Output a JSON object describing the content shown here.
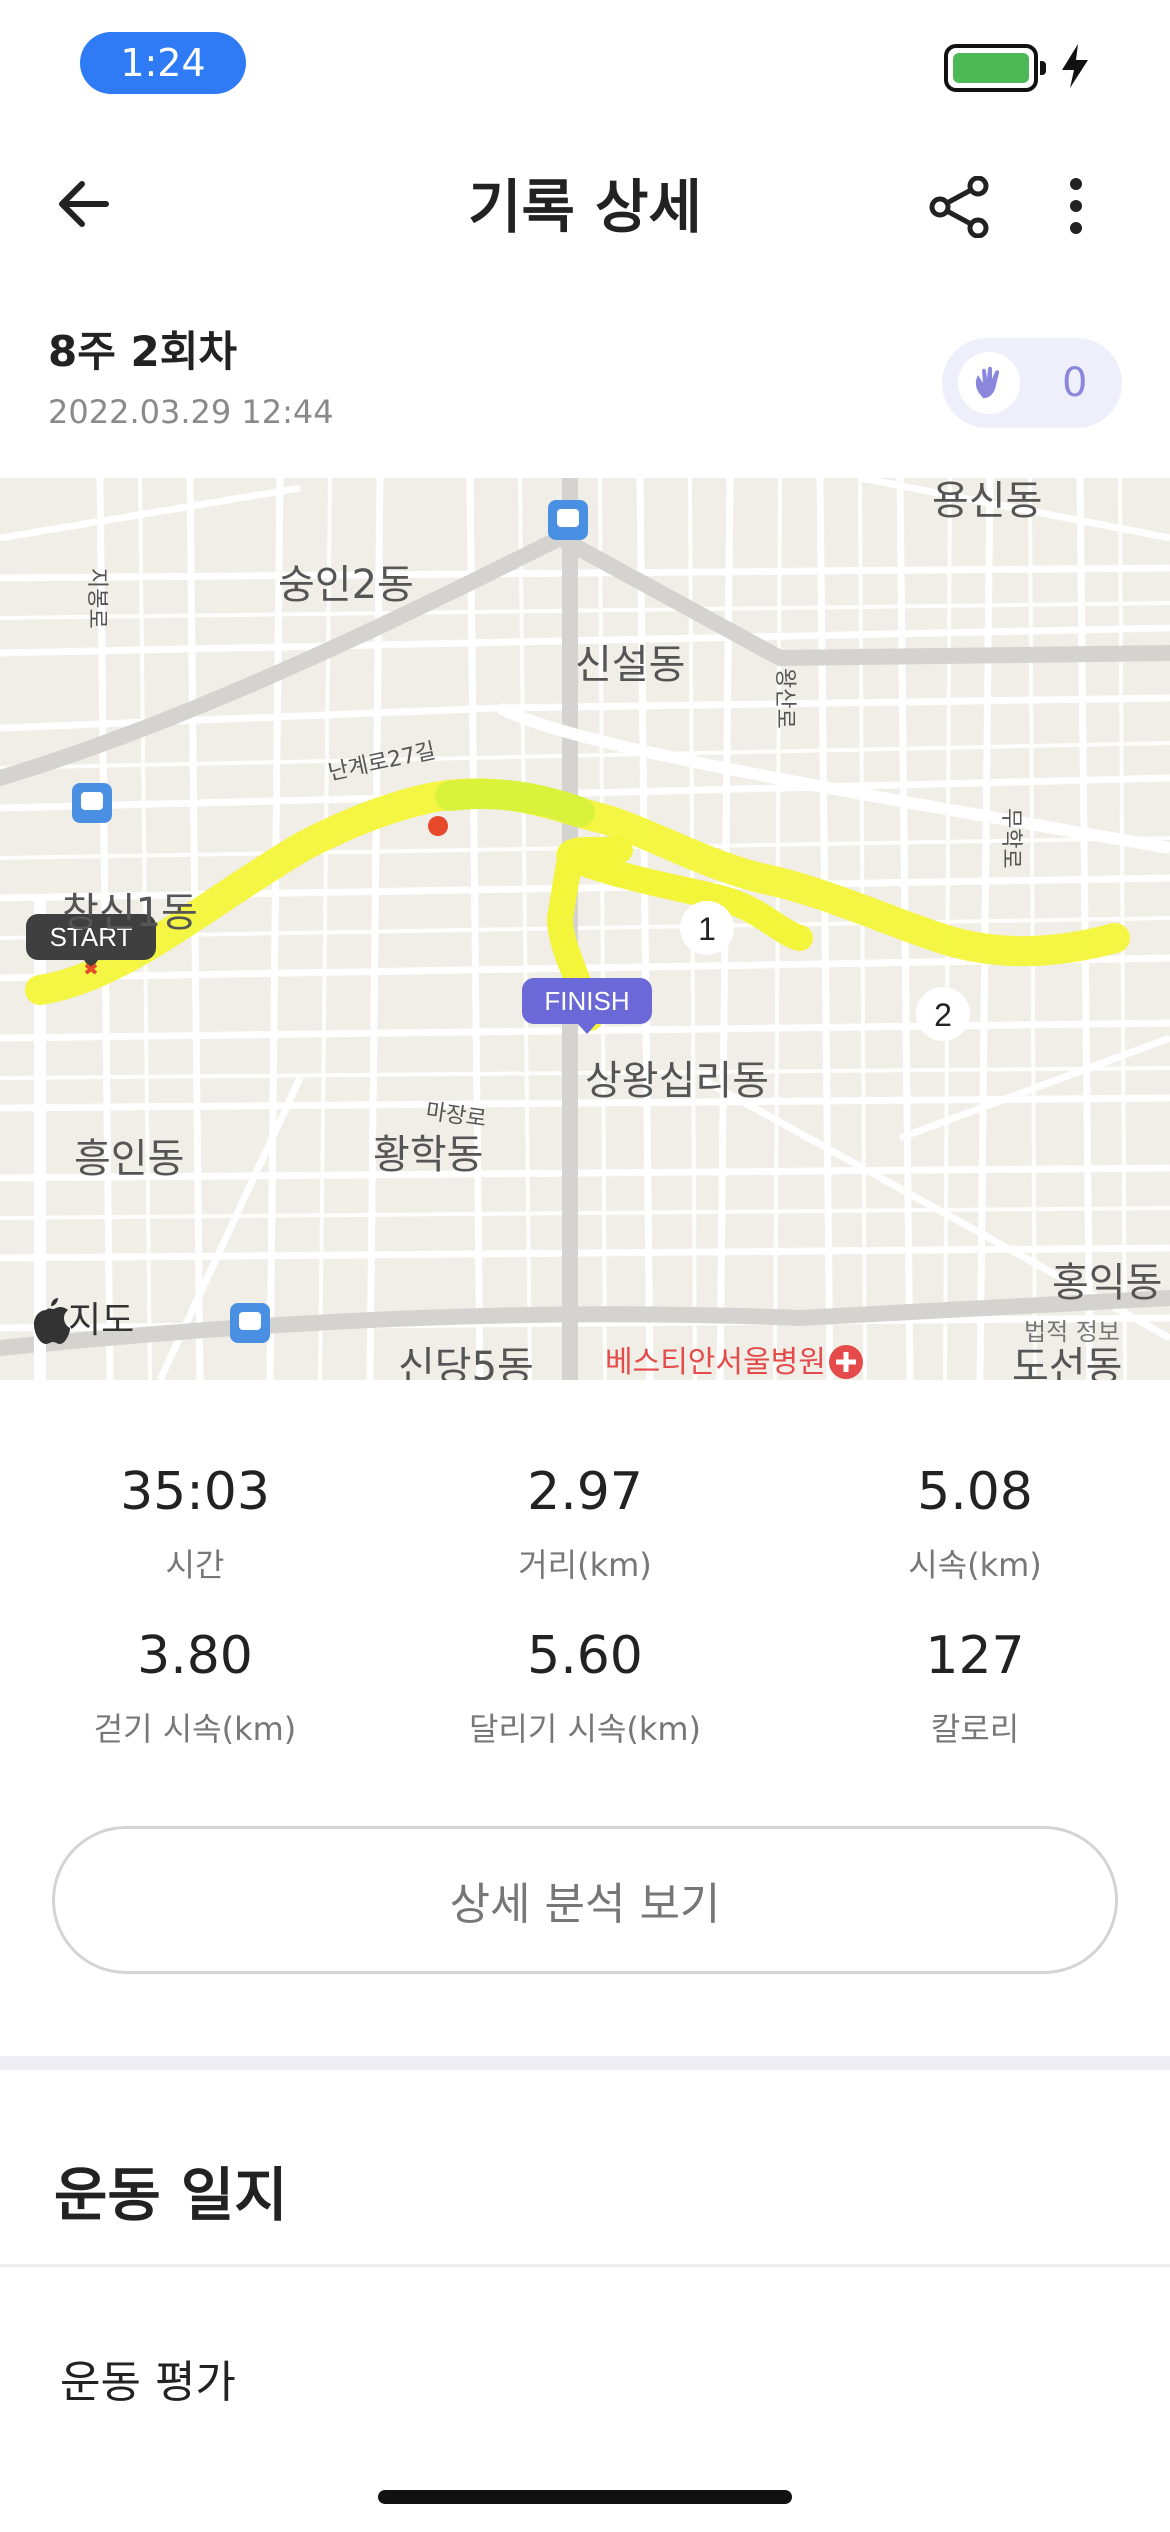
{
  "status_bar": {
    "time": "1:24",
    "battery_color": "#4cb956"
  },
  "header": {
    "title": "기록 상세",
    "back_icon": "arrow-left-icon",
    "share_icon": "share-icon",
    "more_icon": "more-vertical-icon"
  },
  "record": {
    "session": "8주 2회차",
    "datetime": "2022.03.29 12:44",
    "clap_count": "0",
    "clap_icon": "clap-hands-icon"
  },
  "map": {
    "labels": {
      "yongsin": "용신동",
      "sungin2": "숭인2동",
      "sinseol": "신설동",
      "jibong": "지봉로",
      "wangsan": "왕산로",
      "nangye": "난계로27길",
      "muhak": "무학로",
      "changsin1": "창신1동",
      "sangwang": "상왕십리동",
      "majang": "마장로",
      "heungin": "흥인동",
      "hwanghak": "황학동",
      "hongik": "홍익동",
      "sindang5": "신당5동",
      "hospital": "베스티안서울병원",
      "doseon": "도선동",
      "legal": "법적 정보",
      "apple_maps": "지도"
    },
    "start_label": "START",
    "finish_label": "FINISH",
    "markers": [
      "1",
      "2"
    ],
    "route_color": "#f3f53a",
    "finish_color": "#6b68d8"
  },
  "stats": [
    {
      "value": "35:03",
      "label": "시간"
    },
    {
      "value": "2.97",
      "label": "거리(km)"
    },
    {
      "value": "5.08",
      "label": "시속(km)"
    },
    {
      "value": "3.80",
      "label": "걷기 시속(km)"
    },
    {
      "value": "5.60",
      "label": "달리기 시속(km)"
    },
    {
      "value": "127",
      "label": "칼로리"
    }
  ],
  "detail_button": "상세 분석 보기",
  "journal": {
    "title": "운동 일지",
    "evaluation": "운동 평가"
  }
}
